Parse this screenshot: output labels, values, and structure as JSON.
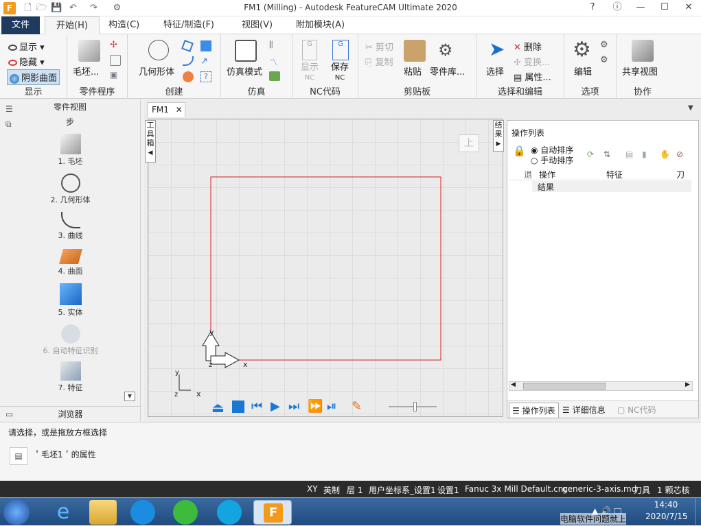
{
  "window": {
    "title": "FM1 (Milling) - Autodesk FeatureCAM Ultimate 2020"
  },
  "menus": [
    "文件",
    "开始(H)",
    "构造(C)",
    "特征/制造(F)",
    "视图(V)",
    "附加模块(A)"
  ],
  "ribbon": {
    "display": {
      "items": [
        "显示",
        "隐藏",
        "阴影曲面"
      ],
      "label": "显示"
    },
    "partprog": {
      "stock": "毛坯...",
      "label": "零件程序"
    },
    "create": {
      "geometry": "几何形体",
      "label": "创建"
    },
    "sim": {
      "mode": "仿真模式",
      "label": "仿真"
    },
    "nc": {
      "show": "显示\nNC",
      "show_a": "显示",
      "show_b": "NC",
      "save_a": "保存",
      "save_b": "NC",
      "label": "NC代码"
    },
    "clipboard": {
      "cut": "剪切",
      "copy": "复制",
      "paste": "粘贴",
      "library": "零件库...",
      "label": "剪贴板"
    },
    "select": {
      "select": "选择",
      "delete": "删除",
      "transform": "变换...",
      "props": "属性...",
      "label": "选择和编辑"
    },
    "options": {
      "edit": "编辑",
      "label": "选项"
    },
    "collab": {
      "share": "共享视图",
      "label": "协作"
    }
  },
  "left": {
    "header": "零件视图",
    "sub": "步",
    "steps": [
      "1. 毛坯",
      "2. 几何形体",
      "3. 曲线",
      "4. 曲面",
      "5. 实体",
      "6. 自动特征识别",
      "7. 特征"
    ],
    "browser": "浏览器"
  },
  "doc": {
    "tab": "FM1",
    "toolbox": "工具箱",
    "results": "结果",
    "view_btn": "上"
  },
  "ops": {
    "title": "操作列表",
    "auto": "自动排序",
    "manual": "手动排序",
    "cols": [
      "操作",
      "特征",
      "刀具"
    ],
    "row": "结果",
    "tabs": [
      "操作列表",
      "详细信息",
      "NC代码"
    ]
  },
  "axes": {
    "y": "y",
    "x": "x",
    "z": "z"
  },
  "status": {
    "prompt": "请选择，或是拖放方框选择",
    "props": "＇毛坯1＇的属性"
  },
  "statusbar": [
    "XY",
    "英制",
    "层 1",
    "用户坐标系_设置1",
    "设置1",
    "Fanuc 3x Mill Default.cnc",
    "generic-3-axis.md",
    "刀具",
    "1 颗芯核"
  ],
  "clock": {
    "time": "14:40",
    "date": "2020/7/15"
  },
  "watermark": "电脑软件问题就上"
}
